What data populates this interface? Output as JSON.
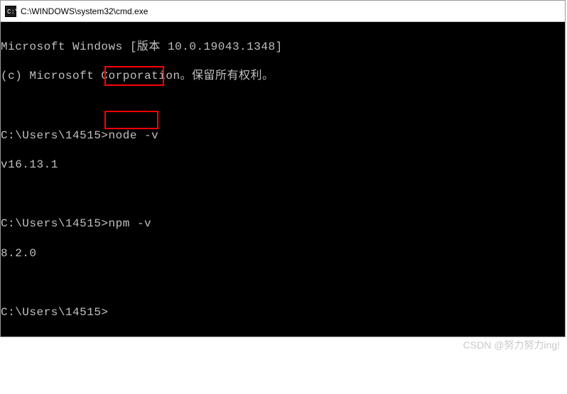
{
  "titlebar": {
    "icon_name": "cmd-icon",
    "title": "C:\\WINDOWS\\system32\\cmd.exe"
  },
  "terminal": {
    "line1": "Microsoft Windows [版本 10.0.19043.1348]",
    "line2": "(c) Microsoft Corporation。保留所有权利。",
    "prompt1_path": "C:\\Users\\14515>",
    "command1": "node -v",
    "output1": "v16.13.1",
    "prompt2_path": "C:\\Users\\14515>",
    "command2": "npm -v",
    "output2": "8.2.0",
    "prompt3_path": "C:\\Users\\14515>"
  },
  "watermark": "CSDN @努力努力ing!"
}
